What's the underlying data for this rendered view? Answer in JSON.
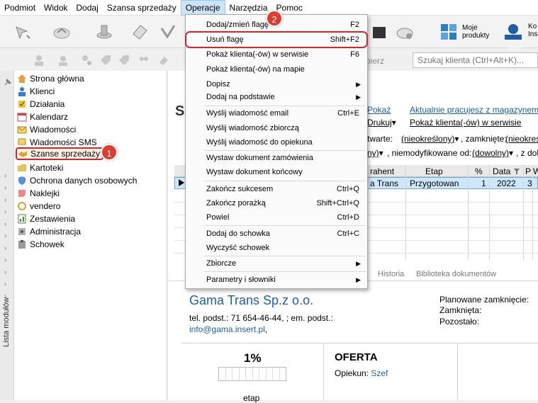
{
  "menubar": {
    "items": [
      "Podmiot",
      "Widok",
      "Dodaj",
      "Szansa sprzedaży",
      "Operacje",
      "Narzędzia",
      "Pomoc"
    ]
  },
  "toolbar": {
    "moje_produkty": "Moje produkty",
    "kon_label": "Ko",
    "kon_label2": "Ins",
    "insert_badge": "InsERT"
  },
  "search": {
    "placeholder": "Szukaj klienta (Ctrl+Alt+K)...",
    "wybierz": "bierz"
  },
  "sidebar": {
    "vertical_label": "Lista modułów",
    "items": [
      "Strona główna",
      "Klienci",
      "Działania",
      "Kalendarz",
      "Wiadomości",
      "Wiadomości SMS",
      "Szanse sprzedaży",
      "Kartoteki",
      "Ochrona danych osobowych",
      "Naklejki",
      "vendero",
      "Zestawienia",
      "Administracja",
      "Schowek"
    ]
  },
  "dropdown": {
    "items": [
      {
        "label": "Dodaj/zmień flagę",
        "shortcut": "F2"
      },
      {
        "label": "Usuń flagę",
        "shortcut": "Shift+F2"
      },
      {
        "label": "Pokaż klienta(-ów) w serwisie",
        "shortcut": "F6"
      },
      {
        "label": "Pokaż klienta(-ów) na mapie",
        "shortcut": ""
      },
      {
        "label": "Dopisz",
        "shortcut": ""
      },
      {
        "label": "Dodaj na podstawie",
        "shortcut": ""
      },
      {
        "label": "Wyślij wiadomość email",
        "shortcut": "Ctrl+E"
      },
      {
        "label": "Wyślij wiadomość zbiorczą",
        "shortcut": ""
      },
      {
        "label": "Wyślij wiadomość do opiekuna",
        "shortcut": ""
      },
      {
        "label": "Wystaw dokument zamówienia",
        "shortcut": ""
      },
      {
        "label": "Wystaw dokument końcowy",
        "shortcut": ""
      },
      {
        "label": "Zakończ sukcesem",
        "shortcut": "Ctrl+Q"
      },
      {
        "label": "Zakończ porażką",
        "shortcut": "Shift+Ctrl+Q"
      },
      {
        "label": "Powiel",
        "shortcut": "Ctrl+D"
      },
      {
        "label": "Dodaj do schowka",
        "shortcut": "Ctrl+C"
      },
      {
        "label": "Wyczyść schowek",
        "shortcut": ""
      },
      {
        "label": "Zbiorcze",
        "shortcut": ""
      },
      {
        "label": "Parametry i słowniki",
        "shortcut": ""
      }
    ]
  },
  "content": {
    "big_s": "S",
    "pokaz_link": "Pokaż",
    "magazyn_link": "Aktualnie pracujesz z magazynem - M",
    "drukuj": "Drukuj",
    "pokaz_serwis": "Pokaż klienta(-ów) w serwisie",
    "otwarte": "twarte:",
    "nieokreslony1": "(nieokreślony)",
    "zamkniete": ", zamknięte:",
    "nieokreslony2": "(nieokreślo",
    "ny": "ny)",
    "niemodyfikowane": ", niemodyfikowane od:",
    "dowolny": "(dowolny)",
    "zdok": ", z dok",
    "grid_headers": {
      "kontrahent": "rahent",
      "etap": "Etap",
      "pct": "%",
      "data": "Data",
      "p": "P",
      "w": "W"
    },
    "grid_row": {
      "kontrahent": "a Trans",
      "etap": "Przygotowan",
      "pct": "1",
      "data": "2022",
      "p": "3"
    },
    "tabs": [
      "Historia",
      "Biblioteka dokumentów"
    ],
    "company": "Gama Trans Sp.z o.o.",
    "tel": "tel. podst.: 71 654-46-44, ; em. podst.:",
    "email": "info@gama.insert.pl",
    "email_suffix": ",",
    "planowane": "Planowane zamknięcie:",
    "zamknieta": "Zamknięta:",
    "pozostalo": "Pozostało:",
    "percent": "1%",
    "etap_label": "etap",
    "oferta": "OFERTA",
    "opiekun_label": "Opiekun:",
    "opiekun_value": "Szef"
  },
  "callouts": {
    "one": "1",
    "two": "2"
  }
}
